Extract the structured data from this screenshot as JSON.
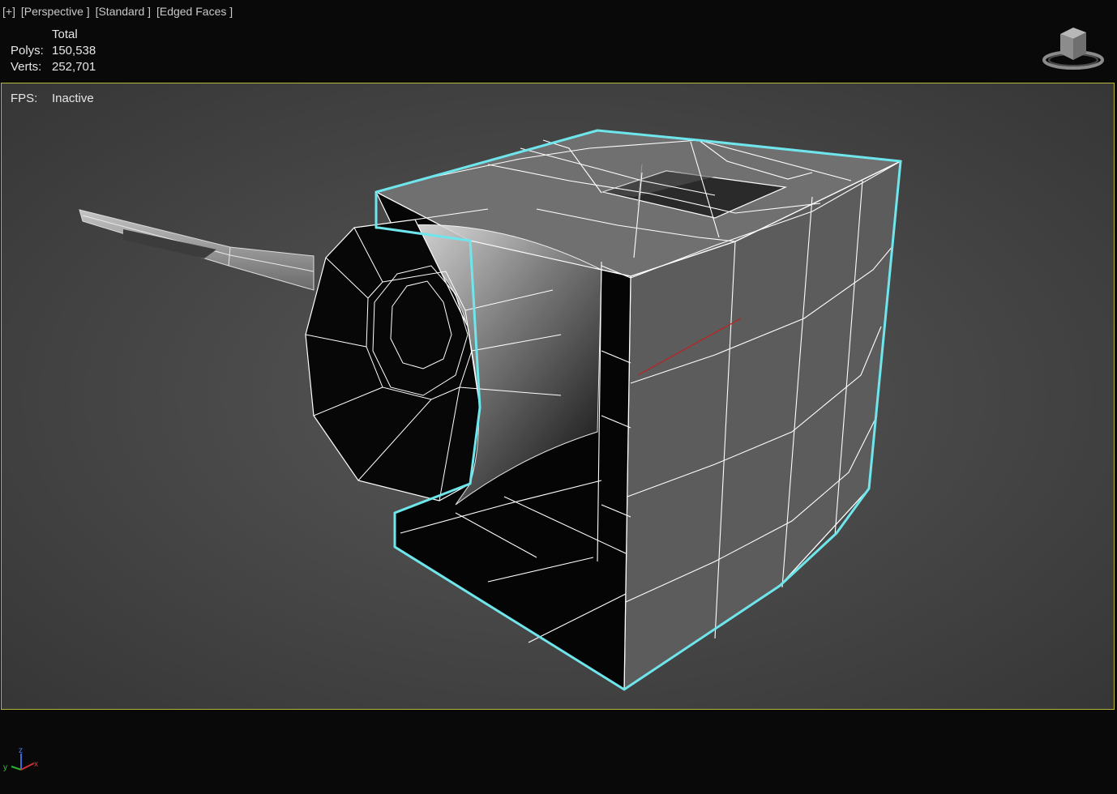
{
  "viewport": {
    "labels": [
      "[+]",
      "[Perspective ]",
      "[Standard ]",
      "[Edged Faces ]"
    ]
  },
  "stats": {
    "header": "Total",
    "polys_label": "Polys:",
    "polys_value": "150,538",
    "verts_label": "Verts:",
    "verts_value": "252,701"
  },
  "fps": {
    "label": "FPS:",
    "value": "Inactive"
  },
  "axis": {
    "z": "z",
    "y": "y",
    "x": "x"
  },
  "colors": {
    "background": "#090909",
    "viewport_border": "#b7b83a",
    "selection_highlight": "#6fe6ec",
    "wire": "#ffffff"
  },
  "icons": {
    "viewcube": "viewcube-icon",
    "axis": "axis-tripod-icon"
  }
}
